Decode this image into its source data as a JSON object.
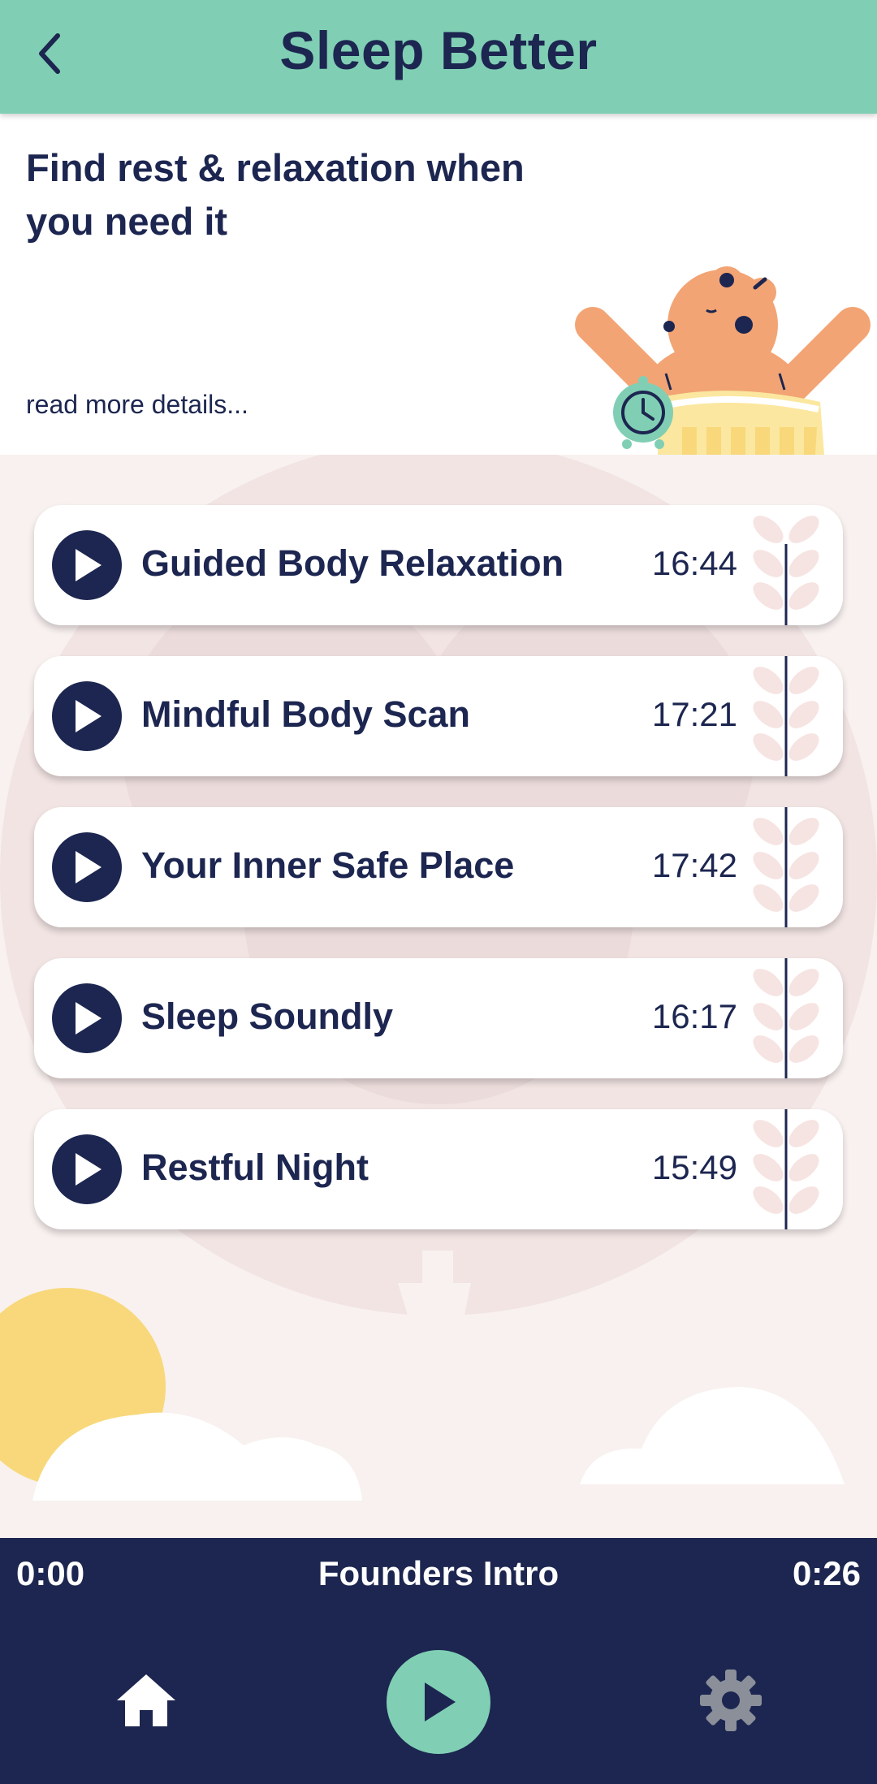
{
  "header": {
    "title": "Sleep Better",
    "back_icon": "chevron-left-icon"
  },
  "intro": {
    "heading": "Find rest & relaxation when you need it",
    "read_more": "read more details..."
  },
  "tracks": [
    {
      "title": "Guided Body Relaxation",
      "duration": "16:44"
    },
    {
      "title": "Mindful Body Scan",
      "duration": "17:21"
    },
    {
      "title": "Your Inner Safe Place",
      "duration": "17:42"
    },
    {
      "title": "Sleep Soundly",
      "duration": "16:17"
    },
    {
      "title": "Restful Night",
      "duration": "15:49"
    }
  ],
  "player": {
    "time_elapsed": "0:00",
    "now_playing": "Founders Intro",
    "time_total": "0:26"
  },
  "nav": {
    "home_icon": "home-icon",
    "play_icon": "play-icon",
    "settings_icon": "gear-icon"
  },
  "colors": {
    "mint": "#80cfb4",
    "navy": "#1c2650",
    "blush": "#f8f1ef",
    "sun": "#f8d87a",
    "bear": "#f2a474"
  }
}
